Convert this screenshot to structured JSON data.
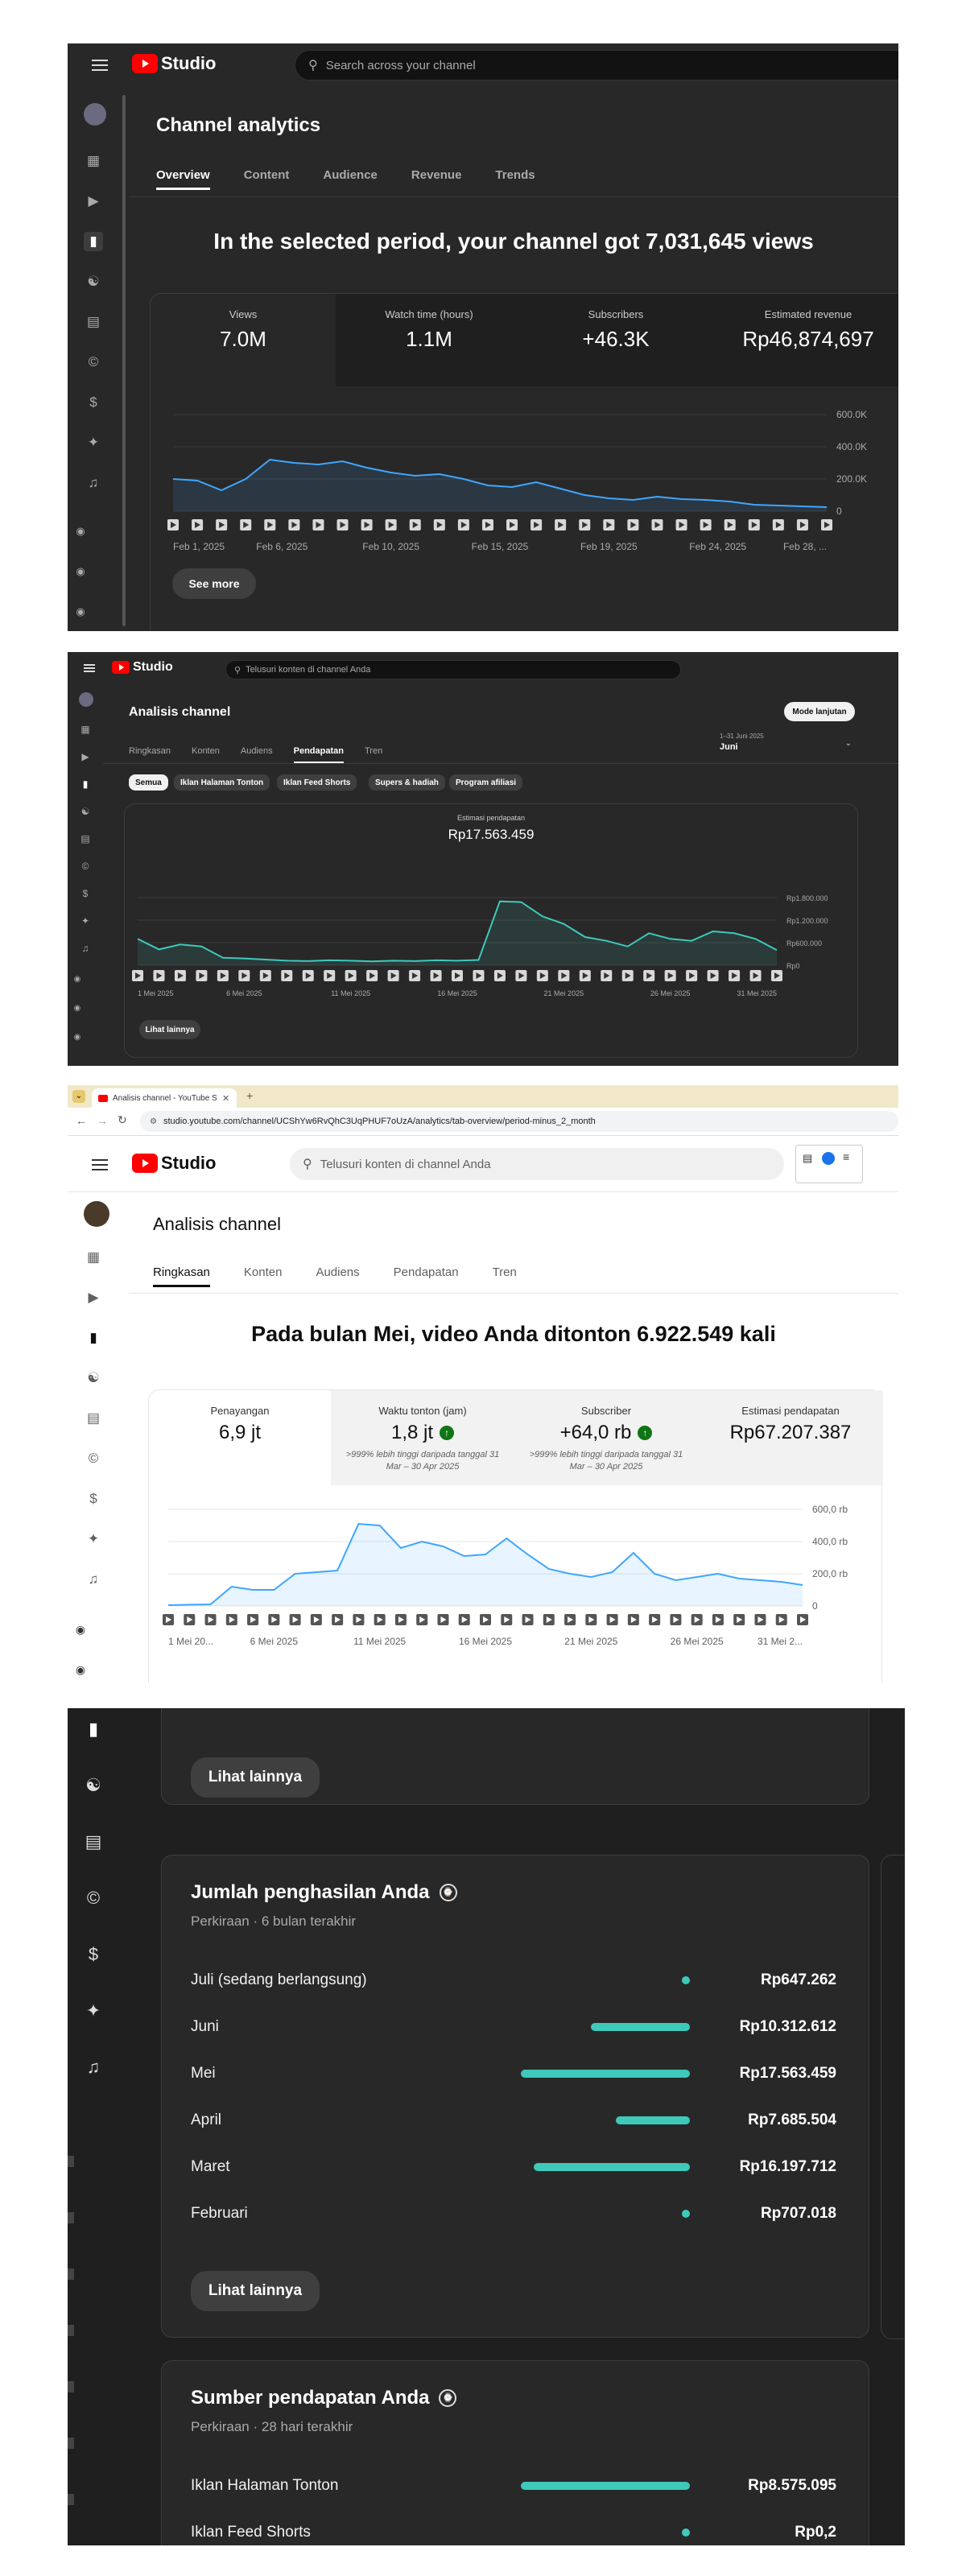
{
  "panel1": {
    "brand": "Studio",
    "search_placeholder": "Search across your channel",
    "page_title": "Channel analytics",
    "tabs": [
      "Overview",
      "Content",
      "Audience",
      "Revenue",
      "Trends"
    ],
    "headline": "In the selected period, your channel got 7,031,645 views",
    "metrics": [
      {
        "label": "Views",
        "value": "7.0M"
      },
      {
        "label": "Watch time (hours)",
        "value": "1.1M"
      },
      {
        "label": "Subscribers",
        "value": "+46.3K"
      },
      {
        "label": "Estimated revenue",
        "value": "Rp46,874,697"
      }
    ],
    "see_more": "See more",
    "chart_data": {
      "type": "area",
      "x_ticks": [
        "Feb 1, 2025",
        "Feb 6, 2025",
        "Feb 10, 2025",
        "Feb 15, 2025",
        "Feb 19, 2025",
        "Feb 24, 2025",
        "Feb 28, ..."
      ],
      "y_ticks": [
        "600.0K",
        "400.0K",
        "200.0K",
        "0"
      ],
      "ylim": [
        0,
        600000
      ],
      "values": [
        200000,
        190000,
        130000,
        200000,
        320000,
        300000,
        290000,
        310000,
        270000,
        240000,
        220000,
        230000,
        200000,
        160000,
        150000,
        180000,
        140000,
        100000,
        80000,
        70000,
        90000,
        75000,
        70000,
        60000,
        40000,
        35000,
        30000,
        25000
      ],
      "color": "#3ea6ff"
    }
  },
  "panel2": {
    "brand": "Studio",
    "search_placeholder": "Telusuri konten di channel Anda",
    "page_title": "Analisis channel",
    "advanced_button": "Mode lanjutan",
    "date_range_sub": "1–31 Juni 2025",
    "date_range": "Juni",
    "tabs": [
      "Ringkasan",
      "Konten",
      "Audiens",
      "Pendapatan",
      "Tren"
    ],
    "chips": [
      "Semua",
      "Iklan Halaman Tonton",
      "Iklan Feed Shorts",
      "Supers & hadiah",
      "Program afiliasi"
    ],
    "metric_label": "Estimasi pendapatan",
    "metric_value": "Rp17.563.459",
    "see_more": "Lihat lainnya",
    "chart_data": {
      "type": "area",
      "x_ticks": [
        "1 Mei 2025",
        "6 Mei 2025",
        "11 Mei 2025",
        "16 Mei 2025",
        "21 Mei 2025",
        "26 Mei 2025",
        "31 Mei 2025"
      ],
      "y_ticks": [
        "Rp1.800.000",
        "Rp1.200.000",
        "Rp600.000",
        "Rp0"
      ],
      "ylim": [
        0,
        1800000
      ],
      "values": [
        700000,
        420000,
        550000,
        500000,
        200000,
        180000,
        150000,
        120000,
        110000,
        130000,
        120000,
        100000,
        120000,
        110000,
        130000,
        120000,
        140000,
        1700000,
        1680000,
        1300000,
        1100000,
        750000,
        650000,
        500000,
        850000,
        700000,
        650000,
        900000,
        850000,
        700000,
        400000
      ],
      "color": "#3ec9bb"
    }
  },
  "panel3": {
    "browser_tab_title": "Analisis channel - YouTube Stu...",
    "url": "studio.youtube.com/channel/UCShYw6RvQhC3UqPHUF7oUzA/analytics/tab-overview/period-minus_2_month",
    "brand": "Studio",
    "search_placeholder": "Telusuri konten di channel Anda",
    "page_title": "Analisis channel",
    "tabs": [
      "Ringkasan",
      "Konten",
      "Audiens",
      "Pendapatan",
      "Tren"
    ],
    "headline": "Pada bulan Mei, video Anda ditonton 6.922.549 kali",
    "metrics": [
      {
        "label": "Penayangan",
        "value": "6,9 jt",
        "note": ""
      },
      {
        "label": "Waktu tonton (jam)",
        "value": "1,8 jt",
        "note": ">999% lebih tinggi daripada tanggal 31 Mar – 30 Apr 2025"
      },
      {
        "label": "Subscriber",
        "value": "+64,0 rb",
        "note": ">999% lebih tinggi daripada tanggal 31 Mar – 30 Apr 2025"
      },
      {
        "label": "Estimasi pendapatan",
        "value": "Rp67.207.387",
        "note": ""
      }
    ],
    "chart_data": {
      "type": "area",
      "x_ticks": [
        "1 Mei 20...",
        "6 Mei 2025",
        "11 Mei 2025",
        "16 Mei 2025",
        "21 Mei 2025",
        "26 Mei 2025",
        "31 Mei 2..."
      ],
      "y_ticks": [
        "600,0 rb",
        "400,0 rb",
        "200,0 rb",
        "0"
      ],
      "ylim": [
        0,
        600000
      ],
      "values": [
        5000,
        8000,
        10000,
        120000,
        100000,
        100000,
        200000,
        210000,
        220000,
        510000,
        500000,
        360000,
        400000,
        370000,
        310000,
        320000,
        420000,
        320000,
        230000,
        200000,
        180000,
        210000,
        330000,
        200000,
        160000,
        180000,
        200000,
        170000,
        160000,
        150000,
        130000
      ],
      "color": "#3ea6ff"
    }
  },
  "panel4": {
    "see_more_top": "Lihat lainnya",
    "earnings": {
      "title": "Jumlah penghasilan Anda",
      "subtitle": "Perkiraan · 6 bulan terakhir",
      "rows": [
        {
          "label": "Juli (sedang berlangsung)",
          "value": "Rp647.262",
          "amount": 647262
        },
        {
          "label": "Juni",
          "value": "Rp10.312.612",
          "amount": 10312612
        },
        {
          "label": "Mei",
          "value": "Rp17.563.459",
          "amount": 17563459
        },
        {
          "label": "April",
          "value": "Rp7.685.504",
          "amount": 7685504
        },
        {
          "label": "Maret",
          "value": "Rp16.197.712",
          "amount": 16197712
        },
        {
          "label": "Februari",
          "value": "Rp707.018",
          "amount": 707018
        }
      ],
      "see_more": "Lihat lainnya"
    },
    "sources": {
      "title": "Sumber pendapatan Anda",
      "subtitle": "Perkiraan · 28 hari terakhir",
      "rows": [
        {
          "label": "Iklan Halaman Tonton",
          "value": "Rp8.575.095",
          "amount": 8575095
        },
        {
          "label": "Iklan Feed Shorts",
          "value": "Rp0,2",
          "amount": 0.2
        }
      ]
    },
    "bar_color": "#3ec9bb"
  }
}
